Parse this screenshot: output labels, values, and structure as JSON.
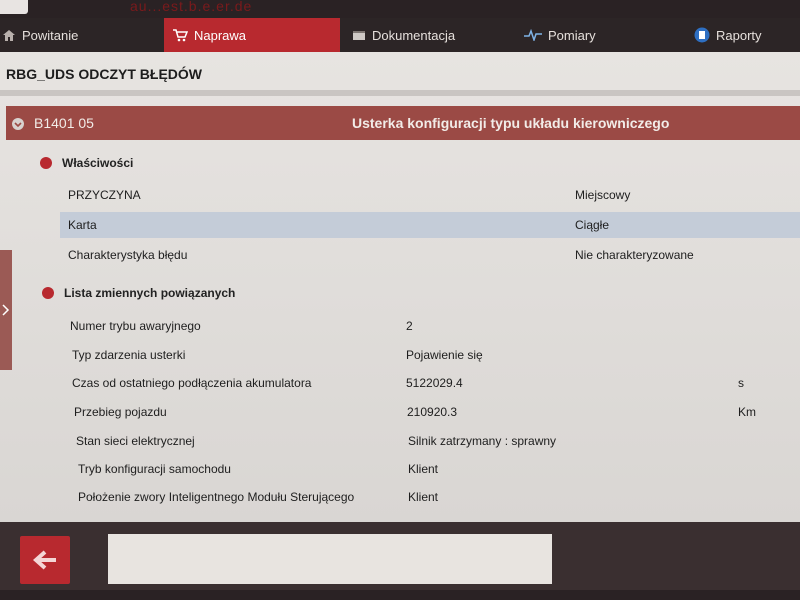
{
  "app": {
    "watermark": "au...est.b.e.er.de"
  },
  "tabs": [
    {
      "label": "Powitanie",
      "icon": "home-icon",
      "active": false
    },
    {
      "label": "Naprawa",
      "icon": "cart-icon",
      "active": true
    },
    {
      "label": "Dokumentacja",
      "icon": "book-icon",
      "active": false
    },
    {
      "label": "Pomiary",
      "icon": "pulse-icon",
      "active": false
    },
    {
      "label": "Raporty",
      "icon": "report-icon",
      "active": false
    }
  ],
  "page": {
    "title": "RBG_UDS ODCZYT BŁĘDÓW"
  },
  "fault": {
    "code": "B1401 05",
    "description": "Usterka konfiguracji typu układu kierowniczego"
  },
  "properties": {
    "title": "Właściwości",
    "rows": [
      {
        "label": "PRZYCZYNA",
        "value": "Miejscowy"
      },
      {
        "label": "Karta",
        "value": "Ciągłe"
      },
      {
        "label": "Charakterystyka błędu",
        "value": "Nie charakteryzowane"
      }
    ]
  },
  "variables": {
    "title": "Lista zmiennych powiązanych",
    "rows": [
      {
        "label": "Numer trybu awaryjnego",
        "value": "2",
        "unit": ""
      },
      {
        "label": "Typ zdarzenia usterki",
        "value": "Pojawienie się",
        "unit": ""
      },
      {
        "label": "Czas od ostatniego podłączenia akumulatora",
        "value": "5122029.4",
        "unit": "s"
      },
      {
        "label": "Przebieg pojazdu",
        "value": "210920.3",
        "unit": "Km"
      },
      {
        "label": "Stan sieci elektrycznej",
        "value": "Silnik zatrzymany : sprawny",
        "unit": ""
      },
      {
        "label": "Tryb konfiguracji samochodu",
        "value": "Klient",
        "unit": ""
      },
      {
        "label": "Położenie zwory Inteligentnego Modułu Sterującego",
        "value": "Klient",
        "unit": ""
      }
    ]
  },
  "colors": {
    "accent": "#b8292f",
    "header_bar": "#9b4a45",
    "highlight_row": "#c4ccd8"
  }
}
